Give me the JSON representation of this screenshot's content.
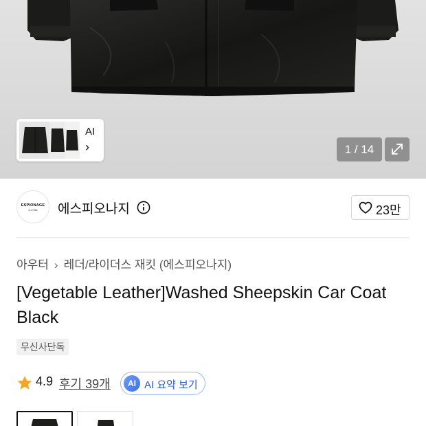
{
  "gallery": {
    "thumbnail_label": "AI",
    "counter": "1 / 14",
    "icons": {
      "chevron": "chevron-right-icon",
      "expand": "expand-icon"
    }
  },
  "brand": {
    "logo_text": "ESPIONAGE",
    "logo_subtext": "6.17'68",
    "name": "에스피오나지",
    "info_icon": "info-icon"
  },
  "like": {
    "count": "23만",
    "icon": "heart-outline-icon"
  },
  "breadcrumb": {
    "items": [
      "아우터",
      "레더/라이더스 재킷 (에스피오나지)"
    ]
  },
  "product": {
    "title": "[Vegetable Leather]Washed Sheepskin Car Coat Black",
    "badge": "무신사단독"
  },
  "rating": {
    "score": "4.9",
    "reviews_label": "후기 39개",
    "ai_badge": "AI",
    "ai_summary_label": "AI 요약 보기"
  },
  "colors": {
    "star": "#F5A524",
    "ai_blue": "#2A58D8",
    "hero_bg": "#DCDCDC"
  }
}
